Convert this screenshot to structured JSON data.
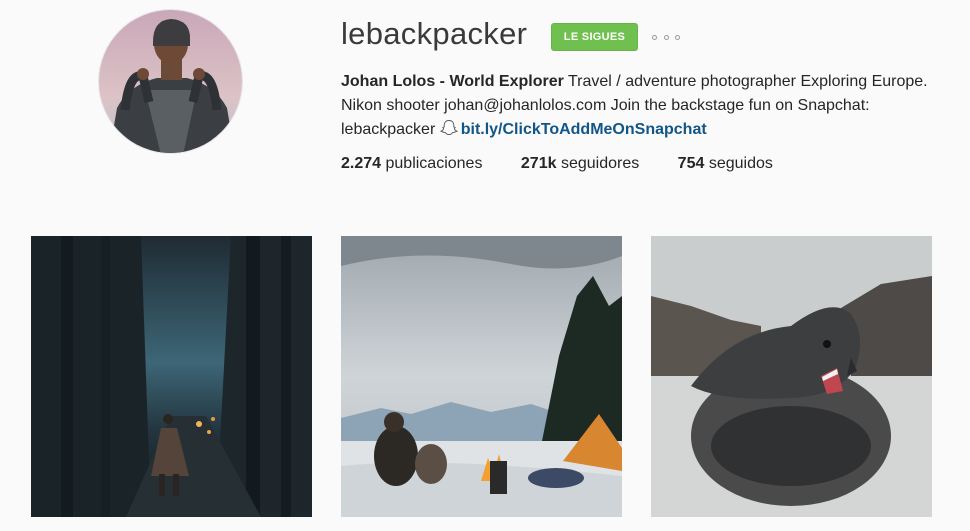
{
  "profile": {
    "username": "lebackpacker",
    "follow_label": "LE SIGUES",
    "bio": {
      "name": "Johan Lolos - World Explorer",
      "line1": " Travel / adventure photographer Exploring Europe.",
      "line2": "Nikon shooter johan@johanlolos.com Join the backstage fun on Snapchat:",
      "line3_prefix": "lebackpacker ",
      "link": "bit.ly/ClickToAddMeOnSnapchat"
    },
    "stats": {
      "posts_count": "2.274",
      "posts_label": " publicaciones",
      "followers_count": "271k",
      "followers_label": " seguidores",
      "following_count": "754",
      "following_label": " seguidos"
    }
  },
  "colors": {
    "follow_green": "#70c050",
    "link_blue": "#125688"
  },
  "icons": {
    "more": "ellipsis-icon",
    "snapchat": "snapchat-ghost-icon"
  }
}
